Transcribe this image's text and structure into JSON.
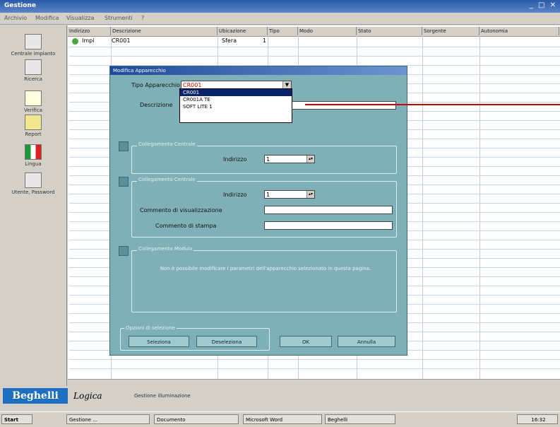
{
  "window": {
    "title": "Gestione",
    "controls": "_ □ ✕"
  },
  "menu": [
    "Archivio",
    "Modifica",
    "Visualizza",
    "Strumenti",
    "?"
  ],
  "toolbar": [
    {
      "label": "Centrale impianto",
      "icon": "building-icon"
    },
    {
      "label": "Ricerca",
      "icon": "search-icon"
    },
    {
      "label": "Verifica",
      "icon": "chart-icon"
    },
    {
      "label": "Report",
      "icon": "table-icon"
    },
    {
      "label": "Lingua",
      "icon": "flag-icon"
    },
    {
      "label": "Utente, Password",
      "icon": "user-icon"
    }
  ],
  "grid": {
    "headers": [
      "Indirizzo",
      "Descrizione",
      "Ubicazione",
      "Tipo",
      "Modo",
      "Stato",
      "Sorgente",
      "Autonomia"
    ],
    "row1": {
      "addr": "Impi",
      "desc": "CR001",
      "ubic": "Sfera",
      "tipo": "1"
    }
  },
  "dialog": {
    "title": "Modifica Apparecchio",
    "tipo_label": "Tipo Apparecchio",
    "tipo_value": "CR001",
    "descr_label": "Descrizione",
    "group1_title": "Collegamento Centrale",
    "grp1_field_label": "Indirizzo",
    "grp1_value": "1",
    "group2_title": "Collegamento Centrale",
    "grp2_field_label": "Indirizzo",
    "grp2_value": "1",
    "comm_label1": "Commento di visualizzazione",
    "comm_label2": "Commento di stampa",
    "group3_title": "Collegamento Modulo",
    "note": "Non è possibile modificare i parametri dell'apparecchio selezionato in questa pagina.",
    "bottom_group_title": "Opzioni di selezione",
    "btn_a": "Seleziona",
    "btn_b": "Deseleziona",
    "btn_ok": "OK",
    "btn_cancel": "Annulla"
  },
  "dropdown": {
    "options": [
      "CR001",
      "CR001A TE",
      "SOFT LITE 1"
    ],
    "selected_index": 0
  },
  "brand": {
    "logo1": "Beghelli",
    "logo2": "Logica",
    "tagline": "Gestione illuminazione"
  },
  "taskbar": {
    "start": "Start",
    "items": [
      "Gestione ...",
      "Documento",
      "Microsoft Word",
      "Beghelli"
    ],
    "clock": "16:32"
  }
}
